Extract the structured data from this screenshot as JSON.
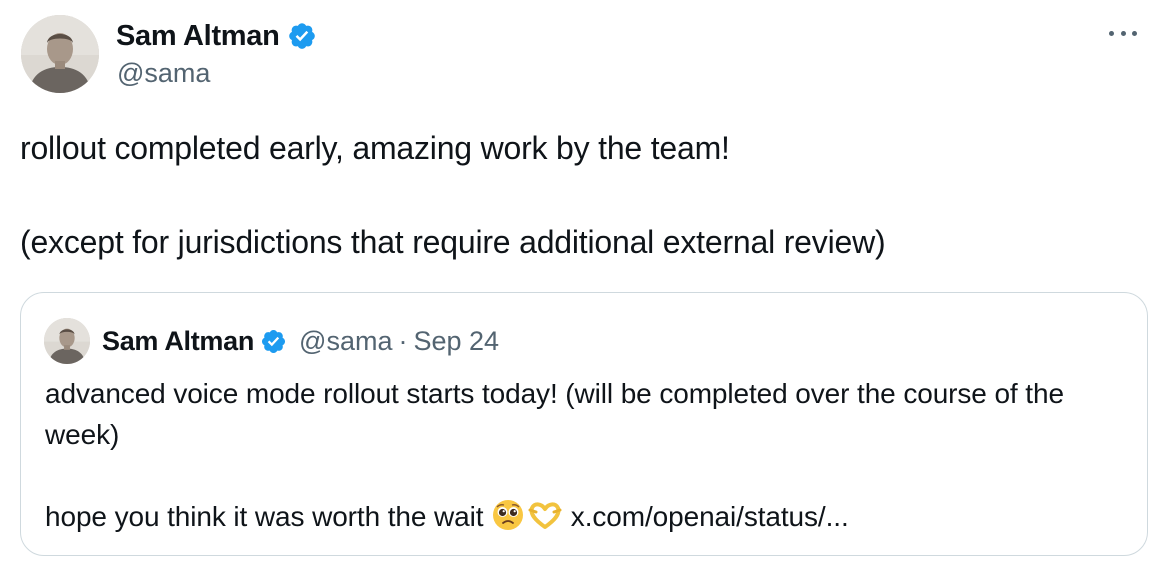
{
  "tweet": {
    "author": {
      "display_name": "Sam Altman",
      "handle": "@sama",
      "verified": true
    },
    "text_lines": [
      "rollout completed early, amazing work by the team!",
      "(except for jurisdictions that require additional external review)"
    ],
    "quoted_tweet": {
      "author": {
        "display_name": "Sam Altman",
        "handle": "@sama",
        "verified": true
      },
      "separator": "·",
      "date": "Sep 24",
      "text_line_1": "advanced voice mode rollout starts today! (will be completed over the course of the week)",
      "text_line_2_prefix": "hope you think it was worth the wait",
      "emojis": [
        "pleading-face-emoji",
        "heart-hands-emoji"
      ],
      "link_text": "x.com/openai/status/..."
    }
  },
  "icons": {
    "verified": "verified-badge-icon",
    "more": "more-options-icon"
  },
  "colors": {
    "text": "#0f1419",
    "secondary_text": "#536471",
    "verified_blue": "#1d9bf0",
    "border": "#cfd9de"
  }
}
